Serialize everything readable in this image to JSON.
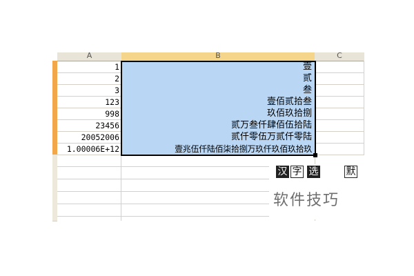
{
  "columns": {
    "a": "A",
    "b": "B",
    "c": "C"
  },
  "rows": [
    {
      "a": "1",
      "b": "壹"
    },
    {
      "a": "2",
      "b": "贰"
    },
    {
      "a": "3",
      "b": "叁"
    },
    {
      "a": "123",
      "b": "壹佰贰拾叁"
    },
    {
      "a": "998",
      "b": "玖佰玖拾捌"
    },
    {
      "a": "23456",
      "b": "贰万叁仟肆佰伍拾陆"
    },
    {
      "a": "20052006",
      "b": "贰仟零伍万贰仟零陆"
    },
    {
      "a": "1.00006E+12",
      "b": "壹兆伍仟陆佰柒拾捌万玖仟玖佰玖拾玖"
    }
  ],
  "toolbar": {
    "t1": "汉",
    "t2": "字",
    "t3": "选",
    "t4": "默"
  },
  "watermark": "软件技巧",
  "colors": {
    "selection": "#b9d7f5",
    "row_header_active": "#f2a74b",
    "col_header_active": "#f4d58a"
  }
}
